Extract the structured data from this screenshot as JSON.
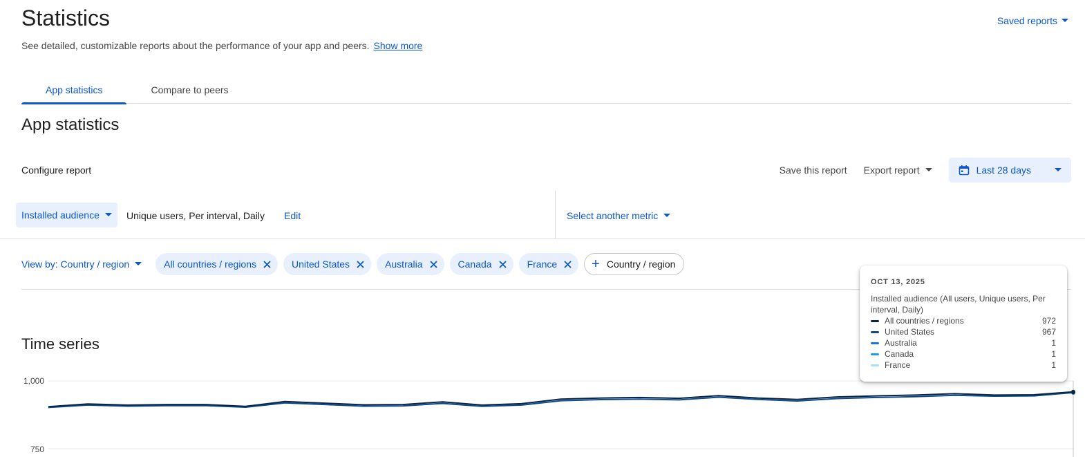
{
  "header": {
    "title": "Statistics",
    "subtitle": "See detailed, customizable reports about the performance of your app and peers.",
    "show_more": "Show more",
    "saved_reports": "Saved reports"
  },
  "tabs": [
    {
      "label": "App statistics",
      "active": true
    },
    {
      "label": "Compare to peers",
      "active": false
    }
  ],
  "section": {
    "title": "App statistics",
    "configure_label": "Configure report",
    "save_report": "Save this report",
    "export_report": "Export report",
    "date_range": "Last 28 days"
  },
  "metric": {
    "name": "Installed audience",
    "description": "Unique users, Per interval, Daily",
    "edit": "Edit",
    "select_another": "Select another metric"
  },
  "filters": {
    "view_by": "View by: Country / region",
    "chips": [
      "All countries / regions",
      "United States",
      "Australia",
      "Canada",
      "France"
    ],
    "add_label": "Country / region"
  },
  "time_series": {
    "title": "Time series"
  },
  "tooltip": {
    "date": "OCT 13, 2025",
    "metric": "Installed audience (All users, Unique users, Per interval, Daily)",
    "rows": [
      {
        "name": "All countries / regions",
        "value": "972",
        "color": "#0b2545"
      },
      {
        "name": "United States",
        "value": "967",
        "color": "#0d4b8c"
      },
      {
        "name": "Australia",
        "value": "1",
        "color": "#1a73e8"
      },
      {
        "name": "Canada",
        "value": "1",
        "color": "#1e9be9"
      },
      {
        "name": "France",
        "value": "1",
        "color": "#a8dcf8"
      }
    ]
  },
  "colors": {
    "accent": "#0b57d0",
    "chip_bg": "#e8f0fe"
  },
  "chart_data": {
    "type": "line",
    "y_ticks": [
      "1,000",
      "750"
    ],
    "ylim": [
      750,
      1000
    ],
    "series": [
      {
        "name": "All countries / regions",
        "color": "#0b2545",
        "values": [
          905,
          915,
          911,
          913,
          913,
          906,
          924,
          918,
          912,
          913,
          923,
          911,
          916,
          933,
          937,
          939,
          936,
          946,
          937,
          932,
          941,
          945,
          948,
          953,
          948,
          949,
          960
        ]
      },
      {
        "name": "United States",
        "color": "#0d4b8c",
        "values": [
          902,
          911,
          907,
          909,
          909,
          903,
          919,
          913,
          907,
          908,
          917,
          906,
          911,
          927,
          931,
          933,
          930,
          940,
          932,
          926,
          935,
          939,
          942,
          947,
          944,
          945,
          957
        ]
      }
    ]
  }
}
